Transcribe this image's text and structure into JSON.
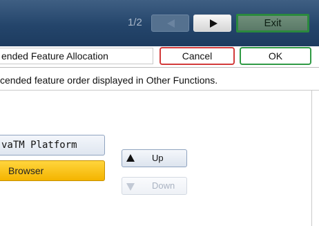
{
  "topbar": {
    "page_indicator": "1/2",
    "prev_icon": "triangle-left-icon",
    "next_icon": "triangle-right-icon",
    "exit_label": "Exit"
  },
  "header": {
    "title": "ended Feature Allocation",
    "cancel_label": "Cancel",
    "ok_label": "OK"
  },
  "instruction": "cended feature order displayed in Other Functions.",
  "list": {
    "items": [
      {
        "label": "vaTM Platform",
        "selected": false
      },
      {
        "label": "Browser",
        "selected": true
      }
    ]
  },
  "controls": {
    "up_label": "Up",
    "up_icon": "triangle-up-icon",
    "down_label": "Down",
    "down_icon": "triangle-down-icon",
    "down_enabled": false
  },
  "colors": {
    "topbar": "#24456b",
    "cancel_border": "#d23a3a",
    "ok_border": "#2f9a44",
    "selected_item": "#f4b400"
  }
}
